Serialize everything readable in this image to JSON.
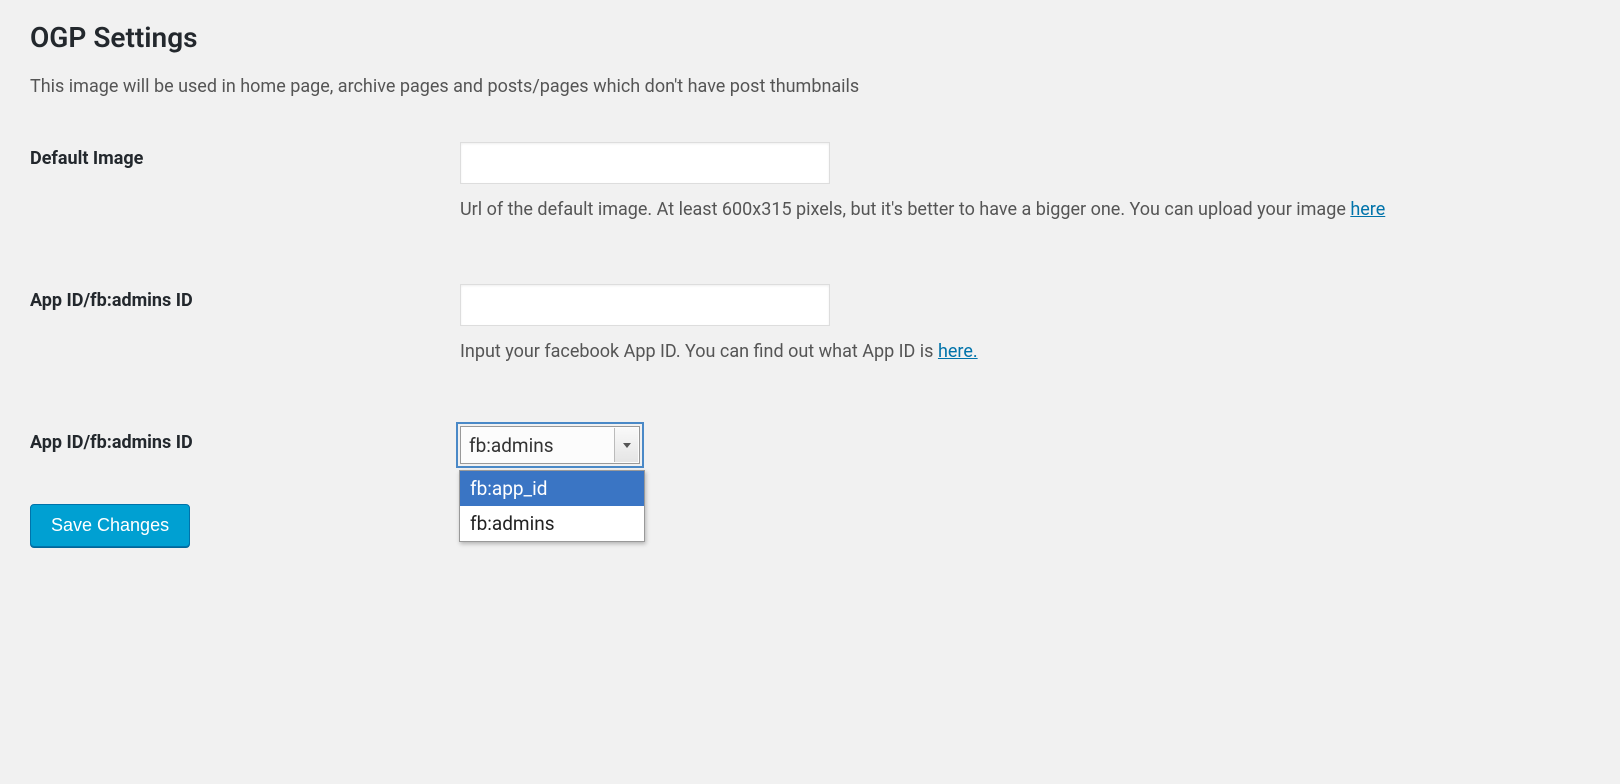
{
  "page": {
    "title": "OGP Settings",
    "description": "This image will be used in home page, archive pages and posts/pages which don't have post thumbnails"
  },
  "fields": {
    "default_image": {
      "label": "Default Image",
      "value": "",
      "help_prefix": "Url of the default image. At least 600x315 pixels, but it's better to have a bigger one. You can upload your image ",
      "help_link": "here"
    },
    "app_id_input": {
      "label": "App ID/fb:admins ID",
      "value": "",
      "help_prefix": "Input your facebook App ID. You can find out what App ID is ",
      "help_link": "here."
    },
    "app_id_select": {
      "label": "App ID/fb:admins ID",
      "selected": "fb:admins",
      "options": [
        "fb:app_id",
        "fb:admins"
      ],
      "option0": "fb:app_id",
      "option1": "fb:admins"
    }
  },
  "buttons": {
    "save": "Save Changes"
  }
}
